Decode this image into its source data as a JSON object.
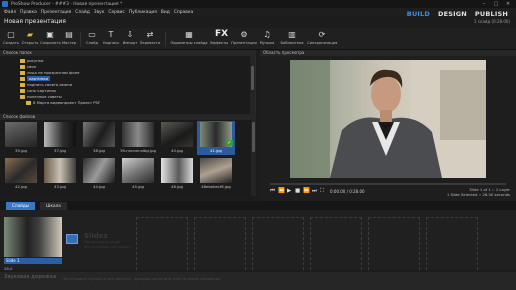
{
  "window": {
    "title": "ProShow Producer - ###3 - Новая презентация *"
  },
  "menu": [
    "Файл",
    "Правка",
    "Презентация",
    "Слайд",
    "Звук",
    "Сервис",
    "Публикация",
    "Вид",
    "Справка"
  ],
  "modes": {
    "build": "BUILD",
    "design": "DESIGN",
    "publish": "PUBLISH"
  },
  "project": {
    "name": "Новая презентация",
    "info": "1 слайд (0:28.00)"
  },
  "toolbar": [
    {
      "label": "Создать",
      "icon": "new-icon"
    },
    {
      "label": "Открыть",
      "icon": "open-icon"
    },
    {
      "label": "Сохранить",
      "icon": "save-icon"
    },
    {
      "label": "Мастер",
      "icon": "wizard-icon"
    },
    {
      "label": "Слайд",
      "icon": "slide-icon"
    },
    {
      "label": "Надпись",
      "icon": "caption-icon"
    },
    {
      "label": "Импорт",
      "icon": "import-icon"
    },
    {
      "label": "Перевести",
      "icon": "convert-icon"
    },
    {
      "label": "Параметры слайда",
      "icon": "slide-options-icon"
    },
    {
      "label": "Эффекты",
      "icon": "effects-icon"
    },
    {
      "label": "Презентация",
      "icon": "presentation-icon"
    },
    {
      "label": "Музыка",
      "icon": "music-icon"
    },
    {
      "label": "Библиотека",
      "icon": "library-icon"
    },
    {
      "label": "Синхронизация",
      "icon": "sync-icon"
    }
  ],
  "folders": {
    "header": "Список папок",
    "items": [
      {
        "label": "рисунки",
        "selected": false
      },
      {
        "label": "свон",
        "selected": false
      },
      {
        "label": "лица не прозрачном фоне",
        "selected": false
      },
      {
        "label": "картинки",
        "selected": true
      },
      {
        "label": "надпись своего имени",
        "selected": false
      },
      {
        "label": "сонь картинок",
        "selected": false
      },
      {
        "label": "полезные советы",
        "selected": false
      },
      {
        "label": "8 Марта видеопроект Проект PSF",
        "selected": false
      }
    ]
  },
  "files": {
    "header": "Список файлов",
    "items": [
      {
        "name": "35.jpg",
        "selected": false
      },
      {
        "name": "37.jpg",
        "selected": false
      },
      {
        "name": "38.jpg",
        "selected": false
      },
      {
        "name": "39-nnnnnnvibg.jpg",
        "selected": false
      },
      {
        "name": "40.jpg",
        "selected": false
      },
      {
        "name": "41.jpg",
        "selected": true
      },
      {
        "name": "42.jpg",
        "selected": false
      },
      {
        "name": "43.jpg",
        "selected": false
      },
      {
        "name": "44.jpg",
        "selected": false
      },
      {
        "name": "45.jpg",
        "selected": false
      },
      {
        "name": "46.jpg",
        "selected": false
      },
      {
        "name": "46ebebecf8.jpg",
        "selected": false
      }
    ]
  },
  "preview": {
    "header": "Область просмотра",
    "time": "0:00.00 / 0:28.00",
    "slide_info": "Slide 1 of 1 :: 1 Layer",
    "selected_info": "1 Slide Selected :: 28.00 seconds"
  },
  "tabs": {
    "slides": "Слайды",
    "timeline": "Шкала"
  },
  "slides": {
    "slide1_label": "Slide 1",
    "slide1_duration": "28.0",
    "empty_title": "Slides",
    "empty_hint": "Перетащите сюда фотографии или видео"
  },
  "soundtrack": {
    "label": "Звуковая дорожка",
    "hint": "Перетащите музыку в эту область. Дважды щелкните для её редактирования."
  },
  "colors": {
    "accent": "#3777c8",
    "build": "#3e8ee8"
  }
}
